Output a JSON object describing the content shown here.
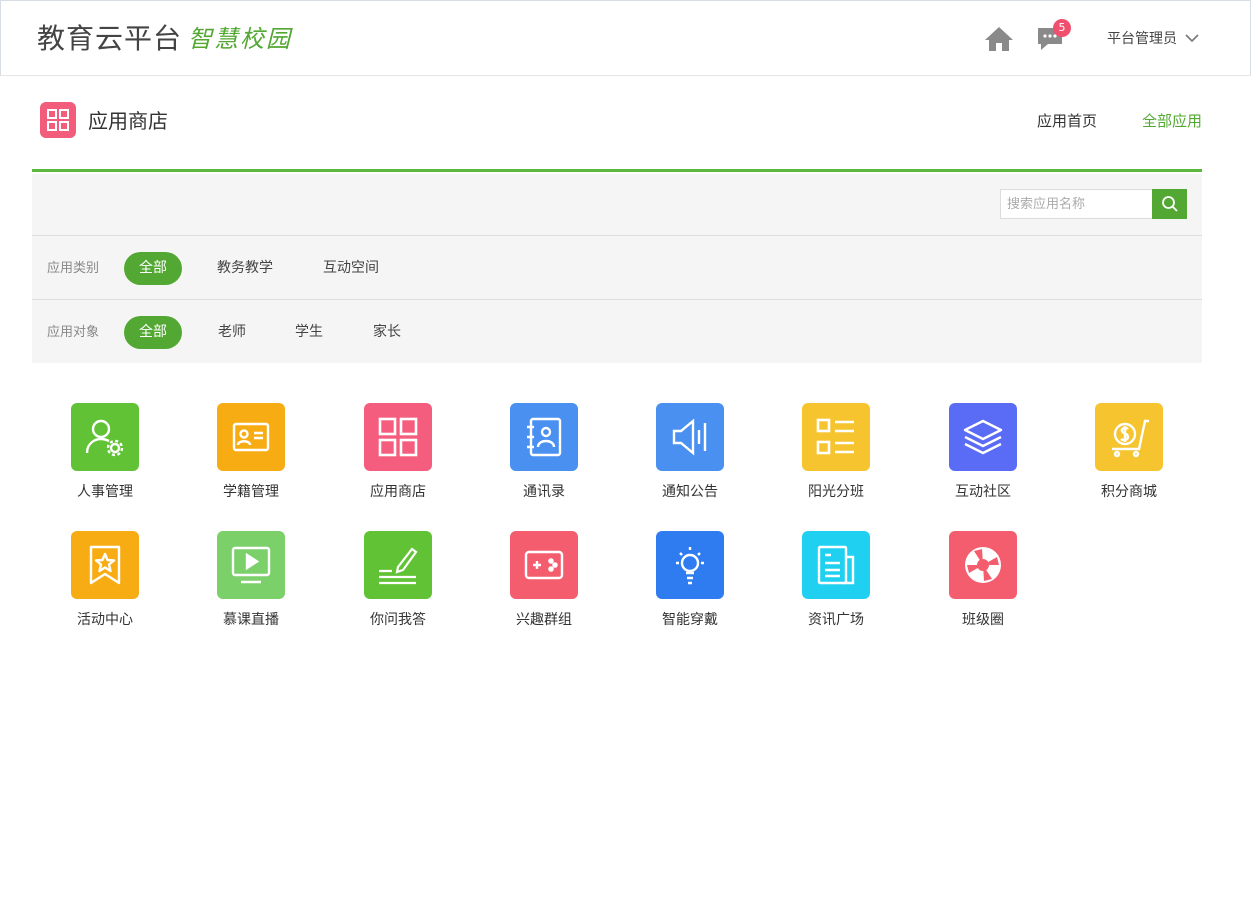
{
  "header": {
    "brand_main": "教育云平台",
    "brand_sub": "智慧校园",
    "message_count": "5",
    "user_name": "平台管理员"
  },
  "store": {
    "title": "应用商店",
    "nav_home": "应用首页",
    "nav_all": "全部应用"
  },
  "search": {
    "placeholder": "搜索应用名称",
    "value": ""
  },
  "filters": {
    "category_label": "应用类别",
    "categories": [
      "全部",
      "教务教学",
      "互动空间"
    ],
    "audience_label": "应用对象",
    "audiences": [
      "全部",
      "老师",
      "学生",
      "家长"
    ]
  },
  "apps": [
    {
      "label": "人事管理",
      "color": "#62c236",
      "icon": "user-gear-icon"
    },
    {
      "label": "学籍管理",
      "color": "#f8ac14",
      "icon": "id-card-icon"
    },
    {
      "label": "应用商店",
      "color": "#f45d7d",
      "icon": "grid-icon"
    },
    {
      "label": "通讯录",
      "color": "#4a90f0",
      "icon": "contact-book-icon"
    },
    {
      "label": "通知公告",
      "color": "#4a90f0",
      "icon": "megaphone-icon"
    },
    {
      "label": "阳光分班",
      "color": "#f6c42f",
      "icon": "list-icon"
    },
    {
      "label": "互动社区",
      "color": "#5a6cf5",
      "icon": "layers-icon"
    },
    {
      "label": "积分商城",
      "color": "#f6c42f",
      "icon": "cart-coin-icon"
    },
    {
      "label": "活动中心",
      "color": "#f8ac14",
      "icon": "star-ribbon-icon"
    },
    {
      "label": "慕课直播",
      "color": "#7cd06a",
      "icon": "play-screen-icon"
    },
    {
      "label": "你问我答",
      "color": "#62c236",
      "icon": "pen-write-icon"
    },
    {
      "label": "兴趣群组",
      "color": "#f45d6e",
      "icon": "gamepad-icon"
    },
    {
      "label": "智能穿戴",
      "color": "#2f7cf0",
      "icon": "bulb-icon"
    },
    {
      "label": "资讯广场",
      "color": "#1fd0f0",
      "icon": "newspaper-icon"
    },
    {
      "label": "班级圈",
      "color": "#f45d6e",
      "icon": "aperture-icon"
    }
  ]
}
